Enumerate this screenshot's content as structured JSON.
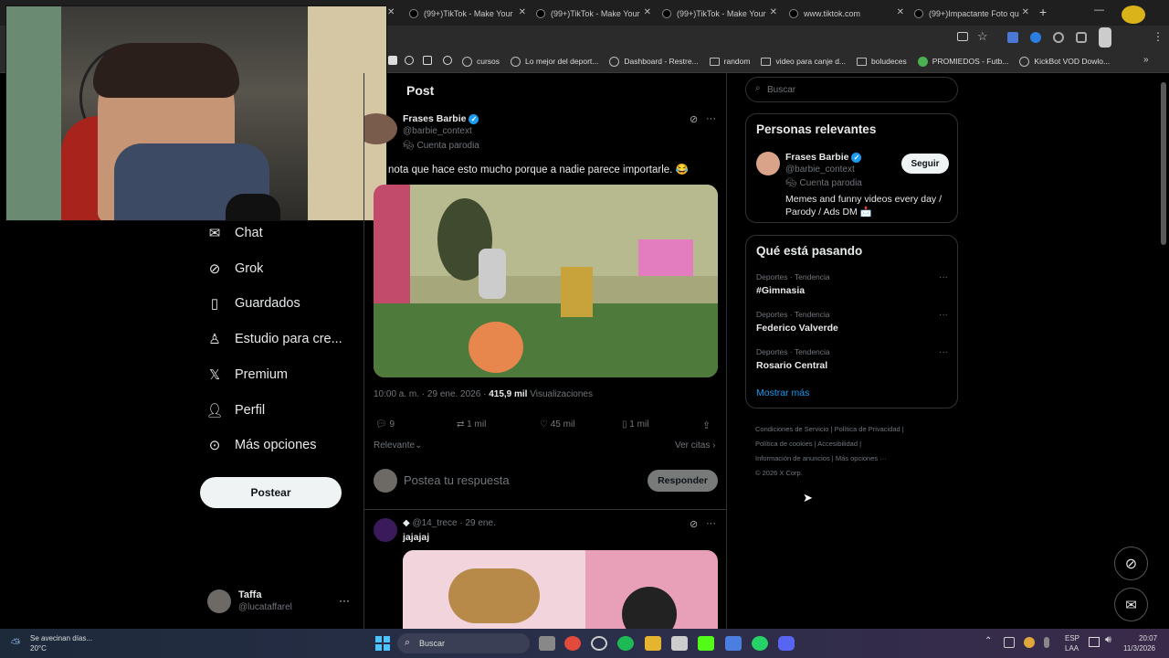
{
  "browser": {
    "tabs": [
      {
        "label": "(99+)TikTok - Make Your"
      },
      {
        "label": "(99+)TikTok - Make Your"
      },
      {
        "label": "(99+)TikTok - Make Your"
      },
      {
        "label": "www.tiktok.com"
      },
      {
        "label": "(99+)Impactante Foto qu"
      }
    ],
    "bookmarks": [
      {
        "label": "cursos",
        "icon": "globe-icon"
      },
      {
        "label": "Lo mejor del deport...",
        "icon": "globe-icon"
      },
      {
        "label": "Dashboard - Restre...",
        "icon": "globe-icon"
      },
      {
        "label": "random",
        "icon": "folder-icon"
      },
      {
        "label": "video para canje d...",
        "icon": "folder-icon"
      },
      {
        "label": "boludeces",
        "icon": "folder-icon"
      },
      {
        "label": "PROMIEDOS - Futb...",
        "icon": "globe-icon"
      },
      {
        "label": "KickBot VOD Dowlo...",
        "icon": "globe-icon"
      }
    ]
  },
  "nav": {
    "items": [
      {
        "label": "Chat",
        "icon": "mail-icon"
      },
      {
        "label": "Grok",
        "icon": "grok-icon"
      },
      {
        "label": "Guardados",
        "icon": "bookmark-icon"
      },
      {
        "label": "Estudio para cre...",
        "icon": "studio-icon"
      },
      {
        "label": "Premium",
        "icon": "x-logo-icon"
      },
      {
        "label": "Perfil",
        "icon": "person-icon"
      },
      {
        "label": "Más opciones",
        "icon": "more-circle-icon"
      }
    ],
    "post_button": "Postear",
    "user": {
      "name": "Taffa",
      "handle": "@lucataffarel"
    }
  },
  "post": {
    "header": "Post",
    "author_name": "Frases Barbie",
    "author_handle": "@barbie_context",
    "parody_label": "Cuenta parodia",
    "text": "nota que hace esto mucho porque a nadie parece importarle. 😂",
    "time": "10:00 a. m. · 29 ene. 2026 ·",
    "views_count": "415,9 mil",
    "views_label": "Visualizaciones",
    "stats": {
      "replies": "9",
      "reposts": "1 mil",
      "likes": "45 mil",
      "bookmarks": "1 mil"
    },
    "sort_label": "Relevante",
    "quotes_label": "Ver citas ›",
    "reply_placeholder": "Postea tu respuesta",
    "reply_button": "Responder"
  },
  "reply": {
    "author": "@14_trece · 29 ene.",
    "text": "jajajaj"
  },
  "sidebar": {
    "search_placeholder": "Buscar",
    "relevant": {
      "title": "Personas relevantes",
      "name": "Frases Barbie",
      "handle": "@barbie_context",
      "parody": "Cuenta parodia",
      "bio": "Memes and funny videos every day / Parody / Ads DM 📩",
      "follow": "Seguir"
    },
    "trends": {
      "title": "Qué está pasando",
      "items": [
        {
          "context": "Deportes · Tendencia",
          "name": "#Gimnasia"
        },
        {
          "context": "Deportes · Tendencia",
          "name": "Federico Valverde"
        },
        {
          "context": "Deportes · Tendencia",
          "name": "Rosario Central"
        }
      ],
      "more": "Mostrar más"
    },
    "footer": {
      "l1a": "Condiciones de Servicio",
      "l1b": "Política de Privacidad",
      "l2a": "Política de cookies",
      "l2b": "Accesibilidad",
      "l3a": "Información de anuncios",
      "l3b": "Más opciones ···",
      "copy": "© 2026 X Corp."
    }
  },
  "taskbar": {
    "weather_text": "Se avecinan días...",
    "weather_temp": "20°C",
    "search": "Buscar",
    "lang1": "ESP",
    "lang2": "LAA",
    "time": "20:07",
    "date": "11/3/2026"
  }
}
